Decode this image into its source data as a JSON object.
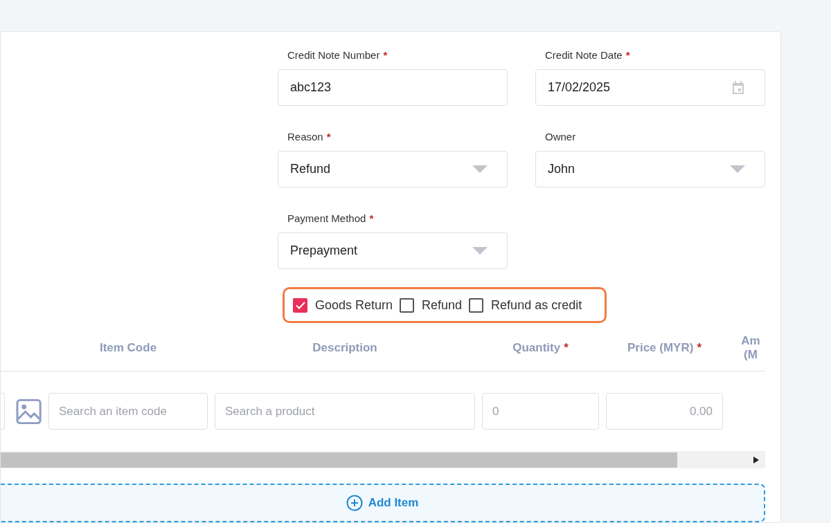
{
  "required_mark": "*",
  "fields": [
    {
      "label": "Credit Note Number",
      "required": true,
      "kind": "text",
      "value": "abc123"
    },
    {
      "label": "Credit Note Date",
      "required": true,
      "kind": "date",
      "value": "17/02/2025"
    },
    {
      "label": "Reason",
      "required": true,
      "kind": "select",
      "value": "Refund"
    },
    {
      "label": "Owner",
      "required": false,
      "kind": "select",
      "value": "John"
    },
    {
      "label": "Payment Method",
      "required": true,
      "kind": "select",
      "value": "Prepayment"
    }
  ],
  "checkboxes": [
    {
      "label": "Goods Return",
      "checked": true
    },
    {
      "label": "Refund",
      "checked": false
    },
    {
      "label": "Refund as credit",
      "checked": false
    }
  ],
  "table": {
    "columns": [
      {
        "lines": [
          "Item Code"
        ],
        "required": false
      },
      {
        "lines": [
          "Description"
        ],
        "required": false
      },
      {
        "lines": [
          "Quantity"
        ],
        "required": true
      },
      {
        "lines": [
          "Price (MYR)"
        ],
        "required": true
      },
      {
        "lines": [
          "Am",
          "(M"
        ],
        "required": false
      }
    ],
    "row": {
      "item_code_placeholder": "Search an item code",
      "product_placeholder": "Search a product",
      "quantity_placeholder": "0",
      "price_placeholder": "0.00"
    }
  },
  "add_item": "Add Item"
}
